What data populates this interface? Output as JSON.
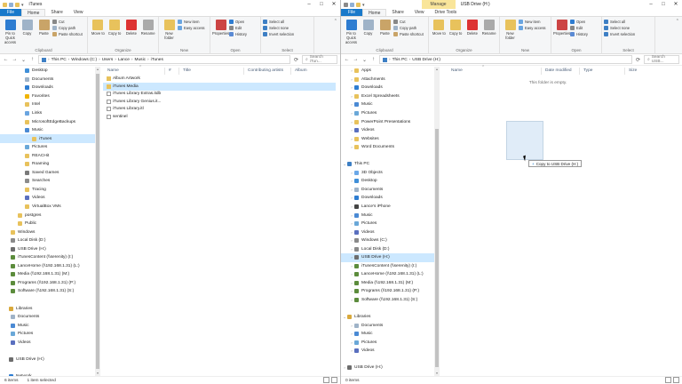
{
  "left": {
    "title": "iTunes",
    "tabs": [
      "File",
      "Home",
      "Share",
      "View"
    ],
    "ribbon": {
      "clipboard": {
        "label": "Clipboard",
        "pin": "Pin to Quick access",
        "copy": "Copy",
        "paste": "Paste",
        "cut": "Cut",
        "copy_path": "Copy path",
        "paste_shortcut": "Paste shortcut"
      },
      "organize": {
        "label": "Organize",
        "move": "Move to",
        "copy": "Copy to",
        "delete": "Delete",
        "rename": "Rename"
      },
      "new": {
        "label": "New",
        "folder": "New folder",
        "item": "New item",
        "easy": "Easy access"
      },
      "open": {
        "label": "Open",
        "properties": "Properties",
        "open": "Open",
        "edit": "Edit",
        "history": "History"
      },
      "select": {
        "label": "Select",
        "all": "Select all",
        "none": "Select none",
        "invert": "Invert selection"
      }
    },
    "address": [
      "This PC",
      "Windows (C:)",
      "Users",
      "Lance",
      "Music",
      "iTunes"
    ],
    "search": "Search iTun...",
    "columns": [
      "Name",
      "#",
      "Title",
      "Contributing artists",
      "Album"
    ],
    "nav": [
      {
        "label": "Desktop",
        "icon": "desktop-icon",
        "indent": 2,
        "arrow": ""
      },
      {
        "label": "Documents",
        "icon": "documents-icon",
        "indent": 2,
        "arrow": ""
      },
      {
        "label": "Downloads",
        "icon": "downloads-icon",
        "indent": 2,
        "arrow": ""
      },
      {
        "label": "Favorites",
        "icon": "favorites-icon",
        "indent": 2,
        "arrow": ""
      },
      {
        "label": "Intel",
        "icon": "folder-icon",
        "indent": 2,
        "arrow": ""
      },
      {
        "label": "Links",
        "icon": "links-icon",
        "indent": 2,
        "arrow": ""
      },
      {
        "label": "MicrosoftEdgeBackups",
        "icon": "folder-icon",
        "indent": 2,
        "arrow": ""
      },
      {
        "label": "Music",
        "icon": "music-icon",
        "indent": 2,
        "arrow": ""
      },
      {
        "label": "iTunes",
        "icon": "folder-icon",
        "indent": 3,
        "arrow": "",
        "selected": true
      },
      {
        "label": "Pictures",
        "icon": "pictures-icon",
        "indent": 2,
        "arrow": ""
      },
      {
        "label": "REACHit",
        "icon": "folder-icon",
        "indent": 2,
        "arrow": ""
      },
      {
        "label": "Roaming",
        "icon": "folder-icon",
        "indent": 2,
        "arrow": ""
      },
      {
        "label": "Saved Games",
        "icon": "saved-games-icon",
        "indent": 2,
        "arrow": ""
      },
      {
        "label": "Searches",
        "icon": "searches-icon",
        "indent": 2,
        "arrow": ""
      },
      {
        "label": "Tracing",
        "icon": "folder-icon",
        "indent": 2,
        "arrow": ""
      },
      {
        "label": "Videos",
        "icon": "videos-icon",
        "indent": 2,
        "arrow": ""
      },
      {
        "label": "VirtualBox VMs",
        "icon": "folder-icon",
        "indent": 2,
        "arrow": ""
      },
      {
        "label": "postgres",
        "icon": "folder-icon",
        "indent": 1,
        "arrow": ""
      },
      {
        "label": "Public",
        "icon": "folder-icon",
        "indent": 1,
        "arrow": ""
      },
      {
        "label": "Windows",
        "icon": "folder-icon",
        "indent": 0,
        "arrow": ""
      },
      {
        "label": "Local Disk (D:)",
        "icon": "drive-icon",
        "indent": 0,
        "arrow": ""
      },
      {
        "label": "USB Drive (H:)",
        "icon": "usb-drive-icon",
        "indent": 0,
        "arrow": ""
      },
      {
        "label": "iTunesContent (\\\\serenity) (I:)",
        "icon": "network-drive-icon",
        "indent": 0,
        "arrow": ""
      },
      {
        "label": "LanceHome (\\\\192.168.1.31) (L:)",
        "icon": "network-drive-icon",
        "indent": 0,
        "arrow": ""
      },
      {
        "label": "Media (\\\\192.168.1.31) (M:)",
        "icon": "network-drive-icon",
        "indent": 0,
        "arrow": ""
      },
      {
        "label": "Programs (\\\\192.168.1.31) (P:)",
        "icon": "network-drive-icon",
        "indent": 0,
        "arrow": ""
      },
      {
        "label": "Software (\\\\192.168.1.31) (S:)",
        "icon": "network-drive-icon",
        "indent": 0,
        "arrow": ""
      },
      {
        "label": "",
        "icon": "",
        "indent": 0,
        "arrow": ""
      },
      {
        "label": "Libraries",
        "icon": "libraries-icon",
        "indent": -1,
        "arrow": ""
      },
      {
        "label": "Documents",
        "icon": "documents-icon",
        "indent": 0,
        "arrow": ""
      },
      {
        "label": "Music",
        "icon": "music-icon",
        "indent": 0,
        "arrow": ""
      },
      {
        "label": "Pictures",
        "icon": "pictures-icon",
        "indent": 0,
        "arrow": ""
      },
      {
        "label": "Videos",
        "icon": "videos-icon",
        "indent": 0,
        "arrow": ""
      },
      {
        "label": "",
        "icon": "",
        "indent": 0,
        "arrow": ""
      },
      {
        "label": "USB Drive (H:)",
        "icon": "usb-drive-icon",
        "indent": -1,
        "arrow": ""
      },
      {
        "label": "",
        "icon": "",
        "indent": 0,
        "arrow": ""
      },
      {
        "label": "Network",
        "icon": "network-icon",
        "indent": -1,
        "arrow": ""
      }
    ],
    "files": [
      {
        "name": "Album Artwork",
        "icon": "folder-icon",
        "selected": false
      },
      {
        "name": "iTunes Media",
        "icon": "folder-icon",
        "selected": true
      },
      {
        "name": "iTunes Library Extras.itdb",
        "icon": "file-icon",
        "selected": false
      },
      {
        "name": "iTunes Library Genius.it...",
        "icon": "file-icon",
        "selected": false
      },
      {
        "name": "iTunes Library.itl",
        "icon": "file-icon",
        "selected": false
      },
      {
        "name": "sentinel",
        "icon": "file-icon",
        "selected": false
      }
    ],
    "status": {
      "items": "6 items",
      "selected": "1 item selected"
    }
  },
  "right": {
    "title": "USB Drive (H:)",
    "manage": "Manage",
    "tabs": [
      "File",
      "Home",
      "Share",
      "View",
      "Drive Tools"
    ],
    "ribbon": {
      "clipboard": {
        "label": "Clipboard",
        "pin": "Pin to Quick access",
        "copy": "Copy",
        "paste": "Paste",
        "cut": "Cut",
        "copy_path": "Copy path",
        "paste_shortcut": "Paste shortcut"
      },
      "organize": {
        "label": "Organize",
        "move": "Move to",
        "copy": "Copy to",
        "delete": "Delete",
        "rename": "Rename"
      },
      "new": {
        "label": "New",
        "folder": "New folder",
        "item": "New item",
        "easy": "Easy access"
      },
      "open": {
        "label": "Open",
        "properties": "Properties",
        "open": "Open",
        "edit": "Edit",
        "history": "History"
      },
      "select": {
        "label": "Select",
        "all": "Select all",
        "none": "Select none",
        "invert": "Invert selection"
      }
    },
    "address": [
      "This PC",
      "USB Drive (H:)"
    ],
    "search": "Search USB...",
    "columns": [
      "Name",
      "Date modified",
      "Type",
      "Size"
    ],
    "empty": "This folder is empty.",
    "nav": [
      {
        "label": "Apps",
        "icon": "folder-icon",
        "indent": 1,
        "arrow": ">"
      },
      {
        "label": "Attachments",
        "icon": "folder-icon",
        "indent": 1,
        "arrow": ">"
      },
      {
        "label": "Downloads",
        "icon": "downloads-icon",
        "indent": 1,
        "arrow": ">"
      },
      {
        "label": "Excel Spreadsheets",
        "icon": "folder-icon",
        "indent": 1,
        "arrow": ">"
      },
      {
        "label": "Music",
        "icon": "music-icon",
        "indent": 1,
        "arrow": ">"
      },
      {
        "label": "Pictures",
        "icon": "pictures-icon",
        "indent": 1,
        "arrow": ">"
      },
      {
        "label": "PowerPoint Presentations",
        "icon": "folder-icon",
        "indent": 1,
        "arrow": ">"
      },
      {
        "label": "Videos",
        "icon": "videos-icon",
        "indent": 1,
        "arrow": ">"
      },
      {
        "label": "Websites",
        "icon": "folder-icon",
        "indent": 1,
        "arrow": ">"
      },
      {
        "label": "Word Documents",
        "icon": "folder-icon",
        "indent": 1,
        "arrow": ">"
      },
      {
        "label": "",
        "icon": "",
        "indent": 0,
        "arrow": ""
      },
      {
        "label": "This PC",
        "icon": "this-pc-icon",
        "indent": 0,
        "arrow": "v"
      },
      {
        "label": "3D Objects",
        "icon": "3d-objects-icon",
        "indent": 1,
        "arrow": ">"
      },
      {
        "label": "Desktop",
        "icon": "desktop-icon",
        "indent": 1,
        "arrow": ">"
      },
      {
        "label": "Documents",
        "icon": "documents-icon",
        "indent": 1,
        "arrow": ">"
      },
      {
        "label": "Downloads",
        "icon": "downloads-icon",
        "indent": 1,
        "arrow": ">"
      },
      {
        "label": "Lance's iPhone",
        "icon": "phone-icon",
        "indent": 1,
        "arrow": ">"
      },
      {
        "label": "Music",
        "icon": "music-icon",
        "indent": 1,
        "arrow": ">"
      },
      {
        "label": "Pictures",
        "icon": "pictures-icon",
        "indent": 1,
        "arrow": ">"
      },
      {
        "label": "Videos",
        "icon": "videos-icon",
        "indent": 1,
        "arrow": ">"
      },
      {
        "label": "Windows (C:)",
        "icon": "drive-icon",
        "indent": 1,
        "arrow": ">"
      },
      {
        "label": "Local Disk (D:)",
        "icon": "drive-icon",
        "indent": 1,
        "arrow": ">"
      },
      {
        "label": "USB Drive (H:)",
        "icon": "usb-drive-icon",
        "indent": 1,
        "arrow": ">",
        "selected": true
      },
      {
        "label": "iTunesContent (\\\\serenity) (I:)",
        "icon": "network-drive-icon",
        "indent": 1,
        "arrow": ">"
      },
      {
        "label": "LanceHome (\\\\192.168.1.31) (L:)",
        "icon": "network-drive-icon",
        "indent": 1,
        "arrow": ">"
      },
      {
        "label": "Media (\\\\192.168.1.31) (M:)",
        "icon": "network-drive-icon",
        "indent": 1,
        "arrow": ">"
      },
      {
        "label": "Programs (\\\\192.168.1.31) (P:)",
        "icon": "network-drive-icon",
        "indent": 1,
        "arrow": ">"
      },
      {
        "label": "Software (\\\\192.168.1.31) (S:)",
        "icon": "network-drive-icon",
        "indent": 1,
        "arrow": ">"
      },
      {
        "label": "",
        "icon": "",
        "indent": 0,
        "arrow": ""
      },
      {
        "label": "Libraries",
        "icon": "libraries-icon",
        "indent": 0,
        "arrow": "v"
      },
      {
        "label": "Documents",
        "icon": "documents-icon",
        "indent": 1,
        "arrow": ">"
      },
      {
        "label": "Music",
        "icon": "music-icon",
        "indent": 1,
        "arrow": ">"
      },
      {
        "label": "Pictures",
        "icon": "pictures-icon",
        "indent": 1,
        "arrow": ">"
      },
      {
        "label": "Videos",
        "icon": "videos-icon",
        "indent": 1,
        "arrow": ">"
      },
      {
        "label": "",
        "icon": "",
        "indent": 0,
        "arrow": ""
      },
      {
        "label": "USB Drive (H:)",
        "icon": "usb-drive-icon",
        "indent": 0,
        "arrow": ">"
      },
      {
        "label": "",
        "icon": "",
        "indent": 0,
        "arrow": ""
      },
      {
        "label": "Network",
        "icon": "network-icon",
        "indent": 0,
        "arrow": ">"
      }
    ],
    "status": {
      "items": "0 items"
    }
  },
  "drag_tooltip": "Copy to USB Drive (H:)",
  "colors": {
    "file_tab": "#1979ca",
    "selection": "#cce8ff",
    "manage_tab": "#f9e59a",
    "folder": "#e8c25c"
  }
}
